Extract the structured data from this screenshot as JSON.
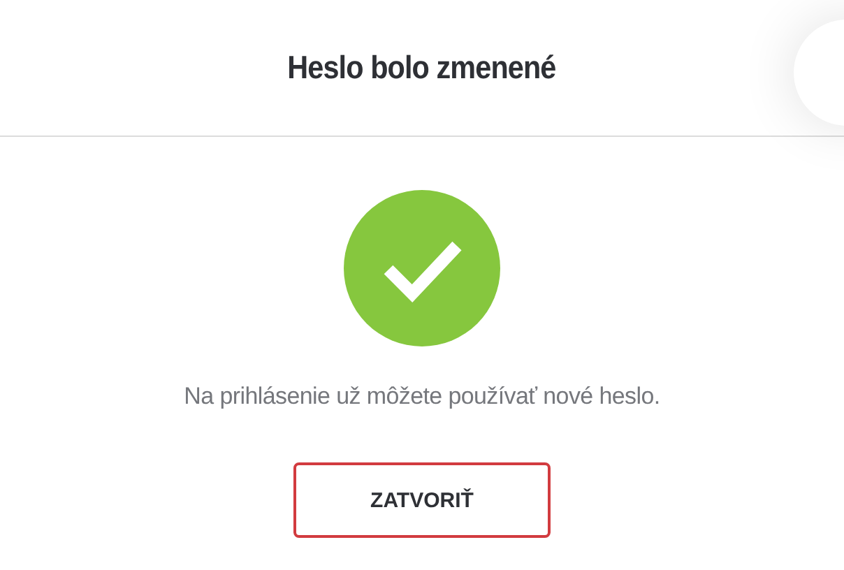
{
  "header": {
    "title": "Heslo bolo zmenené"
  },
  "message": "Na prihlásenie už môžete používať nové heslo.",
  "buttons": [
    "ZATVORIŤ"
  ]
}
